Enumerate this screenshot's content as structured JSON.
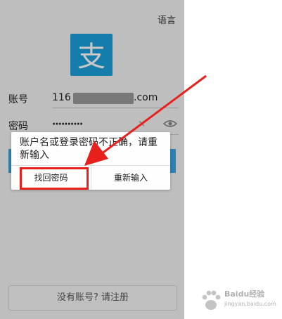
{
  "header": {
    "language_label": "语言"
  },
  "logo": {
    "glyph": "支",
    "color": "#1aa0dc"
  },
  "form": {
    "account_label": "账号",
    "account_prefix": "116",
    "account_suffix": ".com",
    "password_label": "密码",
    "password_mask": "··········",
    "clear_symbol": "×"
  },
  "footer": {
    "register_text": "没有账号? 请注册"
  },
  "dialog": {
    "message": "账户名或登录密码不正确，请重新输入",
    "left_button": "找回密码",
    "right_button": "重新输入"
  },
  "annotation": {
    "color": "#e8201c"
  },
  "watermark": {
    "text": "Baidu经验",
    "sub": "jingyan.baidu.com"
  }
}
